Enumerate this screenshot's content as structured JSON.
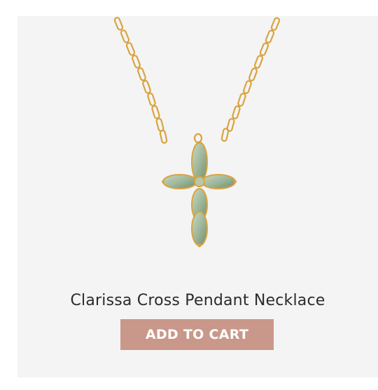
{
  "product": {
    "name": "Clarissa Cross Pendant Necklace",
    "image_subject": "gold chain necklace with green crystal cross pendant"
  },
  "actions": {
    "add_to_cart_label": "ADD TO CART"
  },
  "colors": {
    "card_background": "#f4f4f4",
    "button_background": "#c9988a",
    "button_text": "#ffffff",
    "title_text": "#2b2b2b",
    "gold": "#d9a441",
    "gem_green": "#9fb79a"
  }
}
